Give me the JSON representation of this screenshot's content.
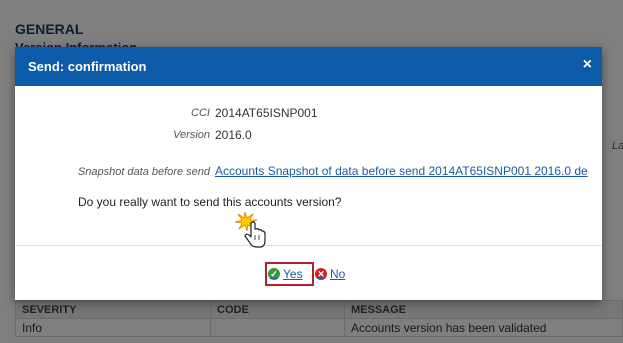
{
  "background": {
    "heading": "GENERAL",
    "subheading": "Version Information",
    "side_label": "La",
    "table": {
      "headers": [
        "SEVERITY",
        "CODE",
        "MESSAGE"
      ],
      "rows": [
        [
          "Info",
          "",
          "Accounts version has been validated"
        ]
      ]
    }
  },
  "modal": {
    "title": "Send: confirmation",
    "close_glyph": "×",
    "fields": {
      "cci_label": "CCI",
      "cci_value": "2014AT65ISNP001",
      "version_label": "Version",
      "version_value": "2016.0",
      "snapshot_label": "Snapshot data before send",
      "snapshot_link": "Accounts Snapshot of data before send 2014AT65ISNP001 2016.0 de"
    },
    "question": "Do you really want to send this accounts version?",
    "buttons": {
      "yes_label": "Yes",
      "no_label": "No",
      "yes_icon": "check-circle-icon",
      "no_icon": "x-circle-icon"
    }
  },
  "colors": {
    "header": "#0b5ba8",
    "link": "#1a5aa8",
    "highlight_border": "#b3222a"
  }
}
